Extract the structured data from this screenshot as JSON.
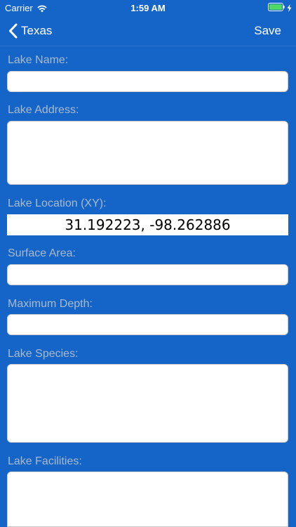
{
  "status_bar": {
    "carrier": "Carrier",
    "time": "1:59 AM",
    "wifi_icon": "wifi-icon",
    "battery_icon": "battery-icon",
    "charging_icon": "bolt-icon"
  },
  "nav": {
    "back_label": "Texas",
    "back_icon": "chevron-left-icon",
    "save_label": "Save"
  },
  "form": {
    "lake_name": {
      "label": "Lake Name:",
      "value": ""
    },
    "lake_address": {
      "label": "Lake Address:",
      "value": ""
    },
    "lake_location": {
      "label": "Lake Location (XY):",
      "value": "31.192223, -98.262886"
    },
    "surface_area": {
      "label": "Surface Area:",
      "value": ""
    },
    "maximum_depth": {
      "label": "Maximum Depth:",
      "value": ""
    },
    "lake_species": {
      "label": "Lake Species:",
      "value": ""
    },
    "lake_facilities": {
      "label": "Lake Facilities:",
      "value": ""
    }
  },
  "colors": {
    "background": "#1565c8",
    "label": "#a9b9cf",
    "battery_fill": "#4cd964"
  }
}
